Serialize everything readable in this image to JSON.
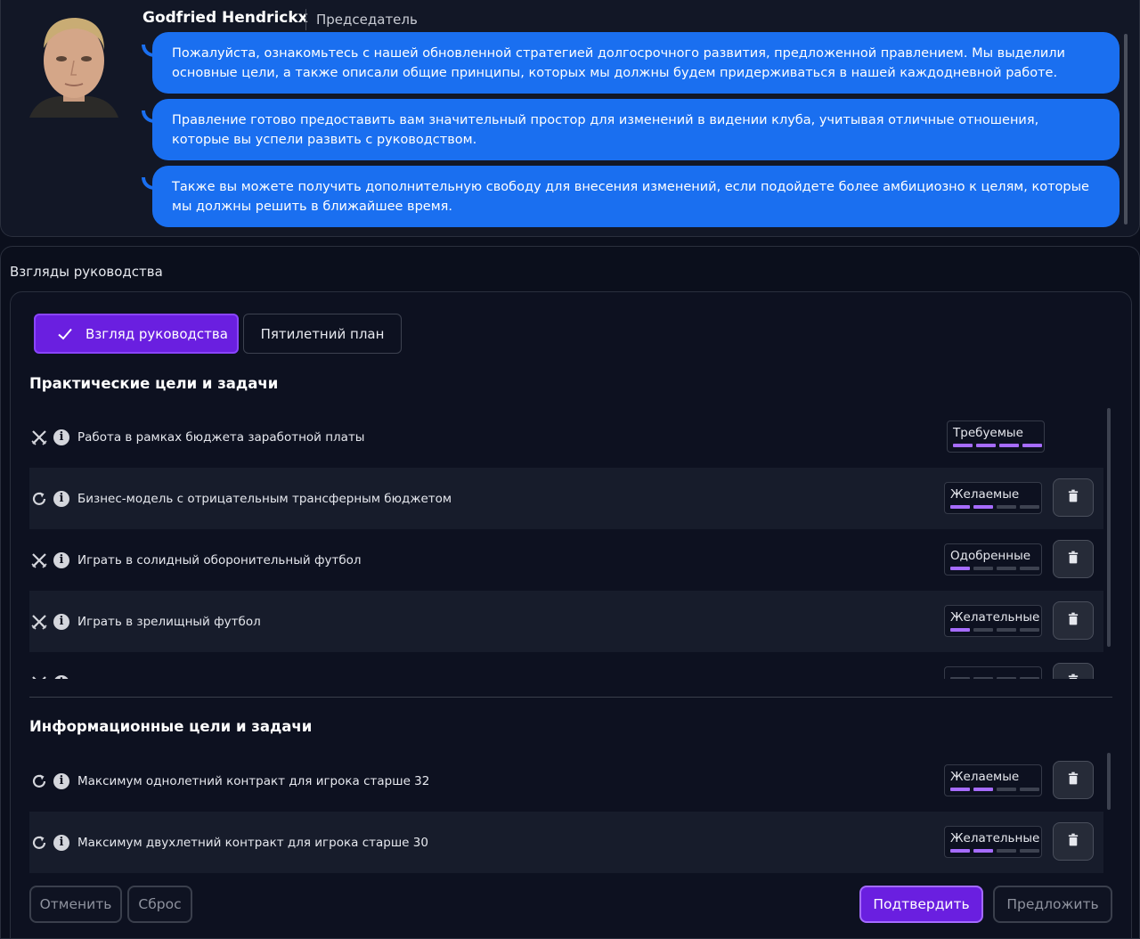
{
  "chat": {
    "name": "Godfried Hendrickx",
    "role": "Председатель",
    "messages": [
      "Пожалуйста, ознакомьтесь с нашей обновленной стратегией долгосрочного развития, предложенной правлением. Мы выделили основные цели, а также описали общие принципы, которых мы должны будем придерживаться в нашей каждодневной работе.",
      "Правление готово предоставить вам значительный простор для изменений в видении клуба, учитывая отличные отношения, которые вы успели развить с руководством.",
      "Также вы можете получить дополнительную свободу для внесения изменений, если подойдете более амбициозно к целям, которые мы должны решить в ближайшее время."
    ]
  },
  "main": {
    "title": "Взгляды руководства",
    "tabs": [
      {
        "label": "Взгляд руководства",
        "active": true
      },
      {
        "label": "Пятилетний план",
        "active": false
      }
    ]
  },
  "practical": {
    "title": "Практические цели и задачи",
    "rows": [
      {
        "icon": "swords-icon",
        "label": "Работа в рамках бюджета заработной платы",
        "badge": "Требуемые",
        "level": 4,
        "deletable": false
      },
      {
        "icon": "refresh-icon",
        "label": "Бизнес-модель с отрицательным трансферным бюджетом",
        "badge": "Желаемые",
        "level": 2,
        "deletable": true
      },
      {
        "icon": "swords-icon",
        "label": "Играть в солидный оборонительный футбол",
        "badge": "Одобренные",
        "level": 1,
        "deletable": true
      },
      {
        "icon": "swords-icon",
        "label": "Играть в зрелищный футбол",
        "badge": "Желательные",
        "level": 1,
        "deletable": true
      },
      {
        "icon": "swords-icon",
        "label": "",
        "badge": "",
        "level": 0,
        "deletable": true
      }
    ]
  },
  "informational": {
    "title": "Информационные цели и задачи",
    "rows": [
      {
        "icon": "refresh-icon",
        "label": "Максимум однолетний контракт для игрока старше 32",
        "badge": "Желаемые",
        "level": 2,
        "deletable": true
      },
      {
        "icon": "refresh-icon",
        "label": "Максимум двухлетний контракт для игрока старше 30",
        "badge": "Желательные",
        "level": 2,
        "deletable": true
      }
    ]
  },
  "footer": {
    "cancel": "Отменить",
    "reset": "Сброс",
    "confirm": "Подтвердить",
    "propose": "Предложить"
  },
  "colors": {
    "accent": "#6a1fe0",
    "bubble": "#1a6ff0",
    "level_bar": "#a66cff"
  }
}
